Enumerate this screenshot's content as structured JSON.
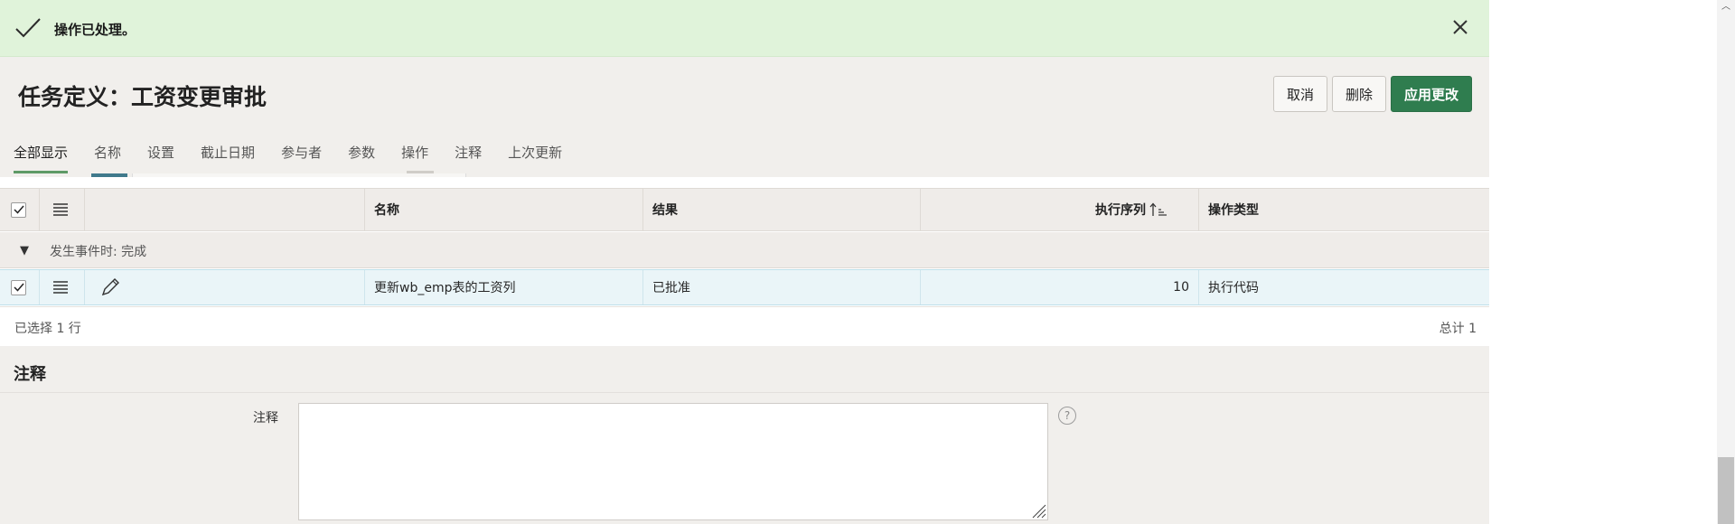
{
  "banner": {
    "message": "操作已处理。",
    "icon": "check-icon",
    "close_icon": "close-icon"
  },
  "header": {
    "title": "任务定义：工资变更审批",
    "cancel_label": "取消",
    "delete_label": "删除",
    "apply_label": "应用更改"
  },
  "tabs": [
    {
      "label": "全部显示",
      "active": true
    },
    {
      "label": "名称"
    },
    {
      "label": "设置"
    },
    {
      "label": "截止日期"
    },
    {
      "label": "参与者"
    },
    {
      "label": "参数"
    },
    {
      "label": "操作"
    },
    {
      "label": "注释"
    },
    {
      "label": "上次更新"
    }
  ],
  "grid": {
    "columns": {
      "name": "名称",
      "result": "结果",
      "seq": "执行序列",
      "type": "操作类型"
    },
    "group_label": "发生事件时: 完成",
    "rows": [
      {
        "name": "更新wb_emp表的工资列",
        "result": "已批准",
        "seq": "10",
        "type": "执行代码"
      }
    ],
    "footer": {
      "selected": "已选择 1 行",
      "total": "总计 1"
    }
  },
  "comments": {
    "section_title": "注释",
    "field_label": "注释",
    "value": "",
    "help": "?"
  },
  "colors": {
    "accent": "#2f7d4f",
    "banner_bg": "#e0f3da",
    "row_selected": "#eaf5f8"
  }
}
